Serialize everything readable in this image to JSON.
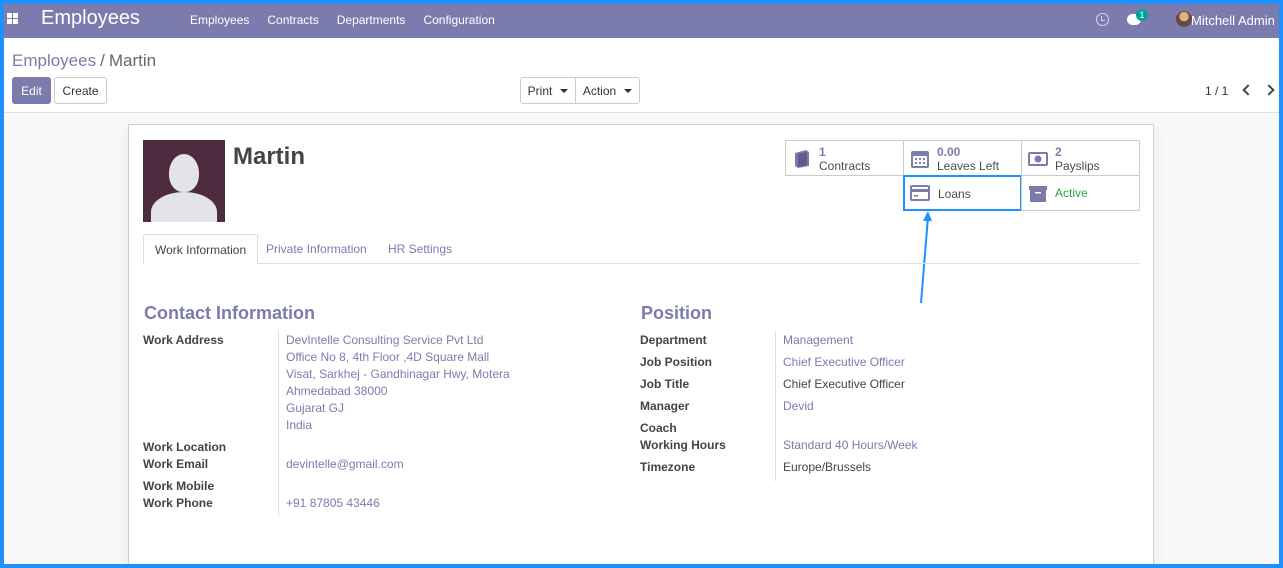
{
  "navbar": {
    "app_title": "Employees",
    "menu": [
      "Employees",
      "Contracts",
      "Departments",
      "Configuration"
    ],
    "chat_badge": "1",
    "user_name": "Mitchell Admin"
  },
  "control_panel": {
    "breadcrumb_parent": "Employees",
    "breadcrumb_sep": "/",
    "breadcrumb_current": "Martin",
    "edit_label": "Edit",
    "create_label": "Create",
    "print_label": "Print",
    "action_label": "Action",
    "pager": "1 / 1"
  },
  "employee": {
    "name": "Martin"
  },
  "smart_buttons": {
    "contracts": {
      "value": "1",
      "label": "Contracts"
    },
    "leaves": {
      "value": "0.00",
      "label": "Leaves Left"
    },
    "payslips": {
      "value": "2",
      "label": "Payslips"
    },
    "loans": {
      "label": "Loans"
    },
    "active": {
      "label": "Active"
    }
  },
  "tabs": [
    "Work Information",
    "Private Information",
    "HR Settings"
  ],
  "contact": {
    "title": "Contact Information",
    "labels": {
      "work_address": "Work Address",
      "work_location": "Work Location",
      "work_email": "Work Email",
      "work_mobile": "Work Mobile",
      "work_phone": "Work Phone"
    },
    "address_lines": [
      "DevIntelle Consulting Service Pvt Ltd",
      "Office No 8, 4th Floor ,4D Square Mall",
      "Visat, Sarkhej - Gandhinagar Hwy, Motera",
      "Ahmedabad 38000",
      "Gujarat GJ",
      "India"
    ],
    "work_email": "devintelle@gmail.com",
    "work_phone": "+91 87805 43446"
  },
  "position": {
    "title": "Position",
    "labels": {
      "department": "Department",
      "job_position": "Job Position",
      "job_title": "Job Title",
      "manager": "Manager",
      "coach": "Coach",
      "working_hours": "Working Hours",
      "timezone": "Timezone"
    },
    "department": "Management",
    "job_position": "Chief Executive Officer",
    "job_title": "Chief Executive Officer",
    "manager": "Devid",
    "working_hours": "Standard 40 Hours/Week",
    "timezone": "Europe/Brussels"
  },
  "colors": {
    "brand": "#7c7bad",
    "highlight": "#1e90ff",
    "active_green": "#28a745"
  }
}
